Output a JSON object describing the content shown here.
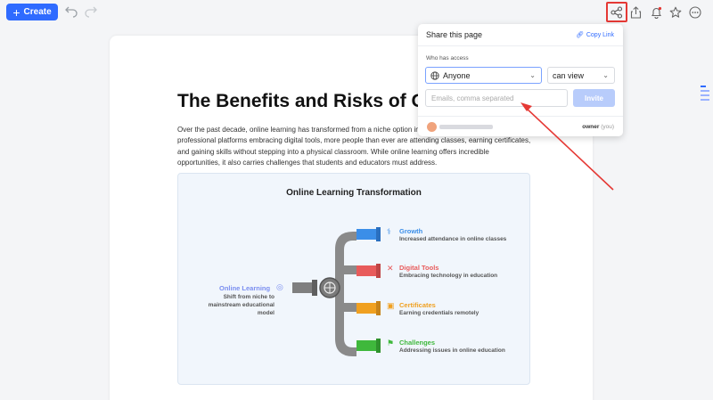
{
  "toolbar": {
    "create_label": "Create",
    "icons": [
      "plus-icon",
      "undo-icon",
      "redo-icon",
      "share-icon",
      "upload-icon",
      "bell-icon",
      "star-icon",
      "more-icon"
    ]
  },
  "document": {
    "title": "The Benefits and Risks of Onl",
    "paragraph": "Over the past decade, online learning has transformed from a niche option in With schools, universities, and professional platforms embracing digital tools, more people than ever are attending classes, earning certificates, and gaining skills without stepping into a physical classroom. While online learning offers incredible opportunities, it also carries challenges that students and educators must address."
  },
  "infographic": {
    "title": "Online Learning Transformation",
    "source": {
      "label": "Online Learning",
      "description": "Shift from niche to mainstream educational model",
      "color": "#7a8ef0"
    },
    "branches": [
      {
        "label": "Growth",
        "description": "Increased attendance in online classes",
        "color": "#3b8ee8",
        "icon": "growth-icon"
      },
      {
        "label": "Digital Tools",
        "description": "Embracing technology in education",
        "color": "#e85b5b",
        "icon": "tools-icon"
      },
      {
        "label": "Certificates",
        "description": "Earning credentials remotely",
        "color": "#f0a020",
        "icon": "certificate-icon"
      },
      {
        "label": "Challenges",
        "description": "Addressing issues in online education",
        "color": "#3fb83c",
        "icon": "challenge-icon"
      }
    ]
  },
  "share_popup": {
    "title": "Share this page",
    "copy_link": "Copy Link",
    "who_has_access": "Who has access",
    "access_option": "Anyone",
    "permission_option": "can view",
    "emails_placeholder": "Emails, comma separated",
    "invite_label": "Invite",
    "owner_label": "owner",
    "owner_suffix": "(you)"
  },
  "colors": {
    "accent": "#2f6bff",
    "highlight": "#e53935"
  }
}
